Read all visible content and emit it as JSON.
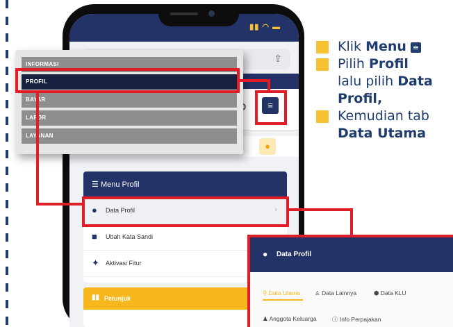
{
  "popup_menu": {
    "items": [
      "INFORMASI",
      "PROFIL",
      "BAYAR",
      "LAPOR",
      "LAYANAN"
    ],
    "active_index": 1
  },
  "menu_profil": {
    "title": "Menu Profil",
    "items": [
      {
        "label": "Data Profil",
        "icon": "user-icon"
      },
      {
        "label": "Ubah Kata Sandi",
        "icon": "lock-icon"
      },
      {
        "label": "Aktivasi Fitur",
        "icon": "pin-icon"
      }
    ]
  },
  "petunjuk": {
    "title": "Petunjuk"
  },
  "data_profil": {
    "title": "Data Profil",
    "tabs": [
      "Data Utama",
      "Data Lainnya",
      "Data KLU",
      "Anggota Keluarga",
      "Info Perpajakan"
    ],
    "active_tab": "Data Utama"
  },
  "instructions": {
    "klik": "Klik",
    "menu_word": "Menu",
    "pilih": "Pilih",
    "profil": "Profil",
    "lalu_pilih": "lalu pilih",
    "data": "Data",
    "profil_comma": "Profil,",
    "kemudian_tab": "Kemudian tab",
    "data_utama": "Data Utama"
  },
  "colors": {
    "accent_red": "#e01e27",
    "navy": "#243367",
    "yellow": "#f6c231"
  }
}
